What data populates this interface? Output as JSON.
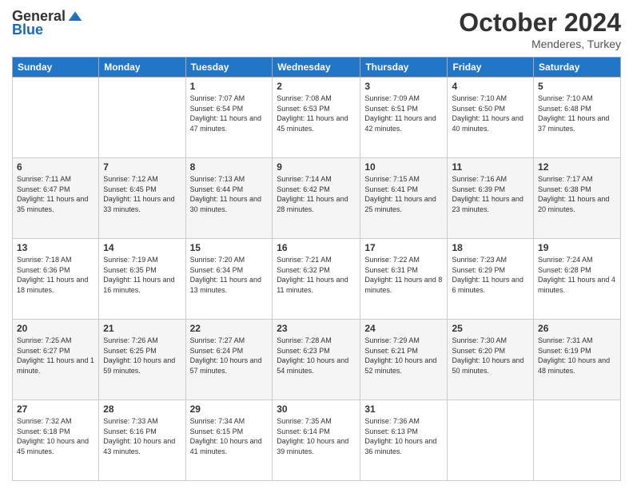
{
  "header": {
    "logo_general": "General",
    "logo_blue": "Blue",
    "month": "October 2024",
    "location": "Menderes, Turkey"
  },
  "days_of_week": [
    "Sunday",
    "Monday",
    "Tuesday",
    "Wednesday",
    "Thursday",
    "Friday",
    "Saturday"
  ],
  "weeks": [
    [
      {
        "day": "",
        "info": ""
      },
      {
        "day": "",
        "info": ""
      },
      {
        "day": "1",
        "info": "Sunrise: 7:07 AM\nSunset: 6:54 PM\nDaylight: 11 hours and 47 minutes."
      },
      {
        "day": "2",
        "info": "Sunrise: 7:08 AM\nSunset: 6:53 PM\nDaylight: 11 hours and 45 minutes."
      },
      {
        "day": "3",
        "info": "Sunrise: 7:09 AM\nSunset: 6:51 PM\nDaylight: 11 hours and 42 minutes."
      },
      {
        "day": "4",
        "info": "Sunrise: 7:10 AM\nSunset: 6:50 PM\nDaylight: 11 hours and 40 minutes."
      },
      {
        "day": "5",
        "info": "Sunrise: 7:10 AM\nSunset: 6:48 PM\nDaylight: 11 hours and 37 minutes."
      }
    ],
    [
      {
        "day": "6",
        "info": "Sunrise: 7:11 AM\nSunset: 6:47 PM\nDaylight: 11 hours and 35 minutes."
      },
      {
        "day": "7",
        "info": "Sunrise: 7:12 AM\nSunset: 6:45 PM\nDaylight: 11 hours and 33 minutes."
      },
      {
        "day": "8",
        "info": "Sunrise: 7:13 AM\nSunset: 6:44 PM\nDaylight: 11 hours and 30 minutes."
      },
      {
        "day": "9",
        "info": "Sunrise: 7:14 AM\nSunset: 6:42 PM\nDaylight: 11 hours and 28 minutes."
      },
      {
        "day": "10",
        "info": "Sunrise: 7:15 AM\nSunset: 6:41 PM\nDaylight: 11 hours and 25 minutes."
      },
      {
        "day": "11",
        "info": "Sunrise: 7:16 AM\nSunset: 6:39 PM\nDaylight: 11 hours and 23 minutes."
      },
      {
        "day": "12",
        "info": "Sunrise: 7:17 AM\nSunset: 6:38 PM\nDaylight: 11 hours and 20 minutes."
      }
    ],
    [
      {
        "day": "13",
        "info": "Sunrise: 7:18 AM\nSunset: 6:36 PM\nDaylight: 11 hours and 18 minutes."
      },
      {
        "day": "14",
        "info": "Sunrise: 7:19 AM\nSunset: 6:35 PM\nDaylight: 11 hours and 16 minutes."
      },
      {
        "day": "15",
        "info": "Sunrise: 7:20 AM\nSunset: 6:34 PM\nDaylight: 11 hours and 13 minutes."
      },
      {
        "day": "16",
        "info": "Sunrise: 7:21 AM\nSunset: 6:32 PM\nDaylight: 11 hours and 11 minutes."
      },
      {
        "day": "17",
        "info": "Sunrise: 7:22 AM\nSunset: 6:31 PM\nDaylight: 11 hours and 8 minutes."
      },
      {
        "day": "18",
        "info": "Sunrise: 7:23 AM\nSunset: 6:29 PM\nDaylight: 11 hours and 6 minutes."
      },
      {
        "day": "19",
        "info": "Sunrise: 7:24 AM\nSunset: 6:28 PM\nDaylight: 11 hours and 4 minutes."
      }
    ],
    [
      {
        "day": "20",
        "info": "Sunrise: 7:25 AM\nSunset: 6:27 PM\nDaylight: 11 hours and 1 minute."
      },
      {
        "day": "21",
        "info": "Sunrise: 7:26 AM\nSunset: 6:25 PM\nDaylight: 10 hours and 59 minutes."
      },
      {
        "day": "22",
        "info": "Sunrise: 7:27 AM\nSunset: 6:24 PM\nDaylight: 10 hours and 57 minutes."
      },
      {
        "day": "23",
        "info": "Sunrise: 7:28 AM\nSunset: 6:23 PM\nDaylight: 10 hours and 54 minutes."
      },
      {
        "day": "24",
        "info": "Sunrise: 7:29 AM\nSunset: 6:21 PM\nDaylight: 10 hours and 52 minutes."
      },
      {
        "day": "25",
        "info": "Sunrise: 7:30 AM\nSunset: 6:20 PM\nDaylight: 10 hours and 50 minutes."
      },
      {
        "day": "26",
        "info": "Sunrise: 7:31 AM\nSunset: 6:19 PM\nDaylight: 10 hours and 48 minutes."
      }
    ],
    [
      {
        "day": "27",
        "info": "Sunrise: 7:32 AM\nSunset: 6:18 PM\nDaylight: 10 hours and 45 minutes."
      },
      {
        "day": "28",
        "info": "Sunrise: 7:33 AM\nSunset: 6:16 PM\nDaylight: 10 hours and 43 minutes."
      },
      {
        "day": "29",
        "info": "Sunrise: 7:34 AM\nSunset: 6:15 PM\nDaylight: 10 hours and 41 minutes."
      },
      {
        "day": "30",
        "info": "Sunrise: 7:35 AM\nSunset: 6:14 PM\nDaylight: 10 hours and 39 minutes."
      },
      {
        "day": "31",
        "info": "Sunrise: 7:36 AM\nSunset: 6:13 PM\nDaylight: 10 hours and 36 minutes."
      },
      {
        "day": "",
        "info": ""
      },
      {
        "day": "",
        "info": ""
      }
    ]
  ]
}
